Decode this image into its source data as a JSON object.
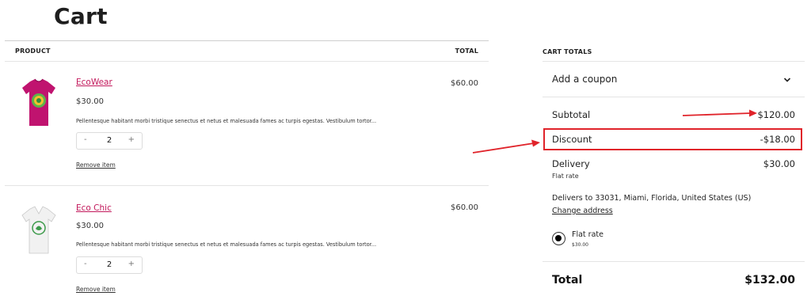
{
  "page": {
    "title": "Cart"
  },
  "cart": {
    "columns": {
      "product": "PRODUCT",
      "total": "TOTAL"
    },
    "items": [
      {
        "name": "EcoWear",
        "price": "$30.00",
        "description": "Pellentesque habitant morbi tristique senectus et netus et malesuada fames ac turpis egestas. Vestibulum tortor...",
        "quantity": "2",
        "minus": "-",
        "plus": "+",
        "remove_label": "Remove item",
        "line_total": "$60.00",
        "thumb_icon": "magenta-tshirt-icon",
        "thumb_color": "#c0136f"
      },
      {
        "name": "Eco Chic",
        "price": "$30.00",
        "description": "Pellentesque habitant morbi tristique senectus et netus et malesuada fames ac turpis egestas. Vestibulum tortor...",
        "quantity": "2",
        "minus": "-",
        "plus": "+",
        "remove_label": "Remove item",
        "line_total": "$60.00",
        "thumb_icon": "white-tshirt-icon",
        "thumb_color": "#eeeeee"
      }
    ]
  },
  "totals": {
    "title": "CART TOTALS",
    "coupon_label": "Add a coupon",
    "subtotal_label": "Subtotal",
    "subtotal_value": "$120.00",
    "discount_label": "Discount",
    "discount_value": "-$18.00",
    "delivery_label": "Delivery",
    "delivery_value": "$30.00",
    "delivery_method": "Flat rate",
    "delivers_to": "Delivers to 33031, Miami, Florida, United States (US)",
    "change_address": "Change address",
    "shipping_option_label": "Flat rate",
    "shipping_option_price": "$30.00",
    "total_label": "Total",
    "total_value": "$132.00"
  },
  "colors": {
    "link": "#c2185b",
    "annotation_red": "#e0232a"
  }
}
